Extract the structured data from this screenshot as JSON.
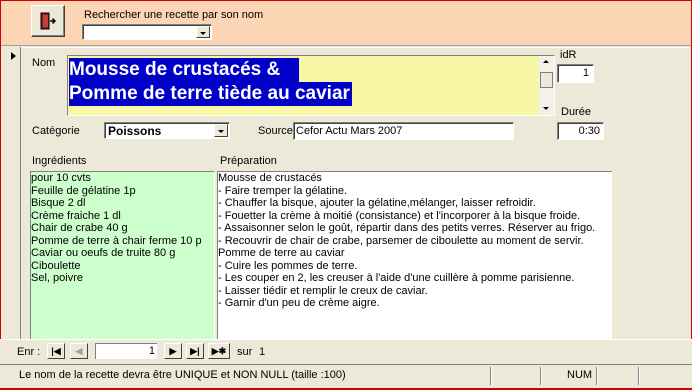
{
  "header": {
    "search_label": "Rechercher une recette par son nom",
    "search_value": ""
  },
  "form": {
    "nom_label": "Nom",
    "nom_line1": "Mousse de crustacés &",
    "nom_line2": "Pomme de terre tiède au caviar",
    "idr_label": "idR",
    "idr_value": "1",
    "duree_label": "Durée",
    "duree_value": "0:30",
    "categorie_label": "Catégorie",
    "categorie_value": "Poissons",
    "source_label": "Source",
    "source_value": "Cefor Actu Mars 2007",
    "ingredients_label": "Ingrédients",
    "ingredients": [
      "pour 10 cvts",
      "Feuille de gélatine 1p",
      "Bisque 2 dl",
      "Crème fraiche 1 dl",
      "Chair de crabe 40 g",
      "Pomme de terre à chair ferme 10 p",
      "Caviar ou oeufs de truite 80 g",
      "Ciboulette",
      "Sel, poivre"
    ],
    "preparation_label": "Préparation",
    "preparation": [
      "Mousse de crustacés",
      "- Faire tremper la gélatine.",
      "- Chauffer la bisque, ajouter la gélatine,mélanger, laisser refroidir.",
      "- Fouetter la crème à moitié (consistance) et l'incorporer à la bisque froide.",
      "- Assaisonner selon le goût, répartir dans des petits verres. Réserver au frigo.",
      "- Recouvrir de chair de crabe, parsemer de ciboulette au moment de servir.",
      "",
      "Pomme de terre au caviar",
      "- Cuire les pommes de terre.",
      "- Les couper en 2, les creuser à l'aide d'une cuillère à pomme parisienne.",
      "- Laisser tiédir et remplir le creux de caviar.",
      "- Garnir d'un peu de crème aigre."
    ]
  },
  "navigation": {
    "record_label": "Enr :",
    "current": "1",
    "of_label": "sur",
    "total": "1"
  },
  "status": {
    "message": "Le nom de la recette devra être UNIQUE et NON NULL (taille :100)",
    "num": "NUM"
  },
  "colors": {
    "header_bg": "#fcd5b4",
    "name_bg": "#f7f7a5",
    "ingredients_bg": "#ccffcc",
    "selection": "#0000c8"
  }
}
